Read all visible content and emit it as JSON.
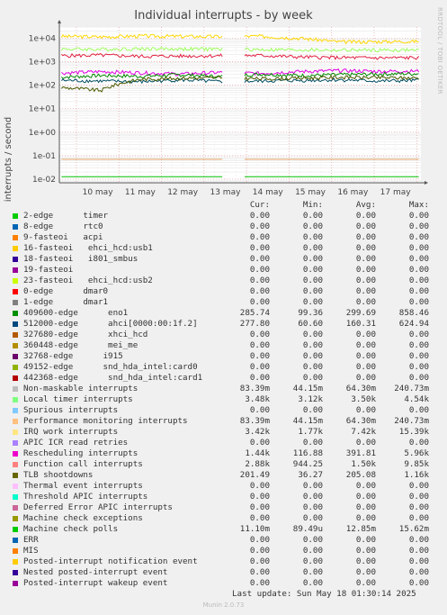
{
  "title": "Individual interrupts - by week",
  "ylabel": "interrupts / second",
  "side_text": "RRDTOOL / TOBI OETIKER",
  "chart_data": {
    "type": "line",
    "title": "Individual interrupts - by week",
    "ylabel": "interrupts / second",
    "yscale": "log",
    "ylim": [
      0.007,
      30000
    ],
    "y_ticks": [
      "1e-02",
      "1e-01",
      "1e+00",
      "1e+01",
      "1e+02",
      "1e+03",
      "1e+04"
    ],
    "x_ticks": [
      "10 may",
      "11 may",
      "12 may",
      "13 may",
      "14 may",
      "15 may",
      "16 may",
      "17 may"
    ],
    "x_range_days": [
      9.6,
      18.1
    ],
    "gap_days": [
      13.45,
      13.95
    ],
    "grid": true,
    "series": [
      {
        "name": "0-edge dmar0 / 8-edge rtc0 (IRQ work)",
        "color": "#ffd700",
        "values": [
          12000,
          11500,
          12500,
          12000,
          11800,
          12200,
          10000,
          7000,
          7200,
          7400
        ]
      },
      {
        "name": "Local timer interrupts",
        "color": "#a0ff60",
        "values": [
          3500,
          3400,
          3600,
          3500,
          3480,
          3300,
          3200,
          3100,
          3120,
          3150
        ]
      },
      {
        "name": "Function call interrupts",
        "color": "#e02040",
        "values": [
          1800,
          1900,
          1700,
          1750,
          1800,
          1850,
          1600,
          1500,
          1450,
          1500
        ]
      },
      {
        "name": "Rescheduling interrupts",
        "color": "#e000e0",
        "values": [
          330,
          380,
          340,
          300,
          350,
          320,
          380,
          420,
          390,
          400
        ]
      },
      {
        "name": "409600-edge eno1",
        "color": "#008800",
        "values": [
          220,
          260,
          240,
          280,
          230,
          300,
          260,
          280,
          300,
          310
        ]
      },
      {
        "name": "512000-edge ahci",
        "color": "#004c60",
        "values": [
          160,
          150,
          140,
          170,
          140,
          150,
          160,
          170,
          150,
          160
        ]
      },
      {
        "name": "TLB shootdowns",
        "color": "#4d5c00",
        "values": [
          80,
          60,
          180,
          200,
          210,
          190,
          200,
          220,
          210,
          205
        ]
      },
      {
        "name": "Machine check polls",
        "color": "#00c000",
        "values": [
          0.0128,
          0.0128,
          0.0128,
          0.0128,
          0.0128,
          0.0128,
          0.0128,
          0.0128,
          0.0128,
          0.0128
        ]
      },
      {
        "name": "Machine check exceptions",
        "color": "#e0a060",
        "values": [
          0.07,
          0.07,
          0.07,
          0.07,
          0.07,
          0.07,
          0.07,
          0.07,
          0.07,
          0.07
        ]
      }
    ]
  },
  "legend": {
    "headers": {
      "cur": "Cur:",
      "min": "Min:",
      "avg": "Avg:",
      "max": "Max:"
    },
    "rows": [
      {
        "label": "2-edge      timer",
        "color": "#00cc00",
        "cur": "0.00",
        "min": "0.00",
        "avg": "0.00",
        "max": "0.00"
      },
      {
        "label": "8-edge      rtc0",
        "color": "#0066b3",
        "cur": "0.00",
        "min": "0.00",
        "avg": "0.00",
        "max": "0.00"
      },
      {
        "label": "9-fasteoi   acpi",
        "color": "#ff8000",
        "cur": "0.00",
        "min": "0.00",
        "avg": "0.00",
        "max": "0.00"
      },
      {
        "label": "16-fasteoi   ehci_hcd:usb1",
        "color": "#ffcc00",
        "cur": "0.00",
        "min": "0.00",
        "avg": "0.00",
        "max": "0.00"
      },
      {
        "label": "18-fasteoi   i801_smbus",
        "color": "#330099",
        "cur": "0.00",
        "min": "0.00",
        "avg": "0.00",
        "max": "0.00"
      },
      {
        "label": "19-fasteoi",
        "color": "#990099",
        "cur": "0.00",
        "min": "0.00",
        "avg": "0.00",
        "max": "0.00"
      },
      {
        "label": "23-fasteoi   ehci_hcd:usb2",
        "color": "#ccff00",
        "cur": "0.00",
        "min": "0.00",
        "avg": "0.00",
        "max": "0.00"
      },
      {
        "label": "0-edge      dmar0",
        "color": "#ff0000",
        "cur": "0.00",
        "min": "0.00",
        "avg": "0.00",
        "max": "0.00"
      },
      {
        "label": "1-edge      dmar1",
        "color": "#808080",
        "cur": "0.00",
        "min": "0.00",
        "avg": "0.00",
        "max": "0.00"
      },
      {
        "label": "409600-edge      eno1",
        "color": "#008f00",
        "cur": "285.74",
        "min": "99.36",
        "avg": "299.69",
        "max": "858.46"
      },
      {
        "label": "512000-edge      ahci[0000:00:1f.2]",
        "color": "#00487d",
        "cur": "277.80",
        "min": "60.60",
        "avg": "160.31",
        "max": "624.94"
      },
      {
        "label": "327680-edge      xhci_hcd",
        "color": "#b35a00",
        "cur": "0.00",
        "min": "0.00",
        "avg": "0.00",
        "max": "0.00"
      },
      {
        "label": "360448-edge      mei_me",
        "color": "#b38f00",
        "cur": "0.00",
        "min": "0.00",
        "avg": "0.00",
        "max": "0.00"
      },
      {
        "label": "32768-edge      i915",
        "color": "#6b006b",
        "cur": "0.00",
        "min": "0.00",
        "avg": "0.00",
        "max": "0.00"
      },
      {
        "label": "49152-edge      snd_hda_intel:card0",
        "color": "#8fb300",
        "cur": "0.00",
        "min": "0.00",
        "avg": "0.00",
        "max": "0.00"
      },
      {
        "label": "442368-edge      snd_hda_intel:card1",
        "color": "#b30000",
        "cur": "0.00",
        "min": "0.00",
        "avg": "0.00",
        "max": "0.00"
      },
      {
        "label": "Non-maskable interrupts",
        "color": "#bebebe",
        "cur": "83.39m",
        "min": "44.15m",
        "avg": "64.30m",
        "max": "240.73m"
      },
      {
        "label": "Local timer interrupts",
        "color": "#80ff80",
        "cur": "3.48k",
        "min": "3.12k",
        "avg": "3.50k",
        "max": "4.54k"
      },
      {
        "label": "Spurious interrupts",
        "color": "#80c9ff",
        "cur": "0.00",
        "min": "0.00",
        "avg": "0.00",
        "max": "0.00"
      },
      {
        "label": "Performance monitoring interrupts",
        "color": "#ffc080",
        "cur": "83.39m",
        "min": "44.15m",
        "avg": "64.30m",
        "max": "240.73m"
      },
      {
        "label": "IRQ work interrupts",
        "color": "#ffe680",
        "cur": "3.42k",
        "min": "1.77k",
        "avg": "7.42k",
        "max": "15.39k"
      },
      {
        "label": "APIC ICR read retries",
        "color": "#aa80ff",
        "cur": "0.00",
        "min": "0.00",
        "avg": "0.00",
        "max": "0.00"
      },
      {
        "label": "Rescheduling interrupts",
        "color": "#ee00cc",
        "cur": "1.44k",
        "min": "116.88",
        "avg": "391.81",
        "max": "5.96k"
      },
      {
        "label": "Function call interrupts",
        "color": "#ff8080",
        "cur": "2.88k",
        "min": "944.25",
        "avg": "1.50k",
        "max": "9.85k"
      },
      {
        "label": "TLB shootdowns",
        "color": "#666600",
        "cur": "201.49",
        "min": "36.27",
        "avg": "205.08",
        "max": "1.16k"
      },
      {
        "label": "Thermal event interrupts",
        "color": "#ffbfff",
        "cur": "0.00",
        "min": "0.00",
        "avg": "0.00",
        "max": "0.00"
      },
      {
        "label": "Threshold APIC interrupts",
        "color": "#00ffcc",
        "cur": "0.00",
        "min": "0.00",
        "avg": "0.00",
        "max": "0.00"
      },
      {
        "label": "Deferred Error APIC interrupts",
        "color": "#cc6699",
        "cur": "0.00",
        "min": "0.00",
        "avg": "0.00",
        "max": "0.00"
      },
      {
        "label": "Machine check exceptions",
        "color": "#999900",
        "cur": "0.00",
        "min": "0.00",
        "avg": "0.00",
        "max": "0.00"
      },
      {
        "label": "Machine check polls",
        "color": "#00cc00",
        "cur": "11.10m",
        "min": "89.49u",
        "avg": "12.85m",
        "max": "15.62m"
      },
      {
        "label": "ERR",
        "color": "#0066b3",
        "cur": "0.00",
        "min": "0.00",
        "avg": "0.00",
        "max": "0.00"
      },
      {
        "label": "MIS",
        "color": "#ff8000",
        "cur": "0.00",
        "min": "0.00",
        "avg": "0.00",
        "max": "0.00"
      },
      {
        "label": "Posted-interrupt notification event",
        "color": "#ffcc00",
        "cur": "0.00",
        "min": "0.00",
        "avg": "0.00",
        "max": "0.00"
      },
      {
        "label": "Nested posted-interrupt event",
        "color": "#330099",
        "cur": "0.00",
        "min": "0.00",
        "avg": "0.00",
        "max": "0.00"
      },
      {
        "label": "Posted-interrupt wakeup event",
        "color": "#990099",
        "cur": "0.00",
        "min": "0.00",
        "avg": "0.00",
        "max": "0.00"
      }
    ]
  },
  "last_update": "Last update: Sun May 18 01:30:14 2025",
  "footer": "Munin 2.0.73"
}
